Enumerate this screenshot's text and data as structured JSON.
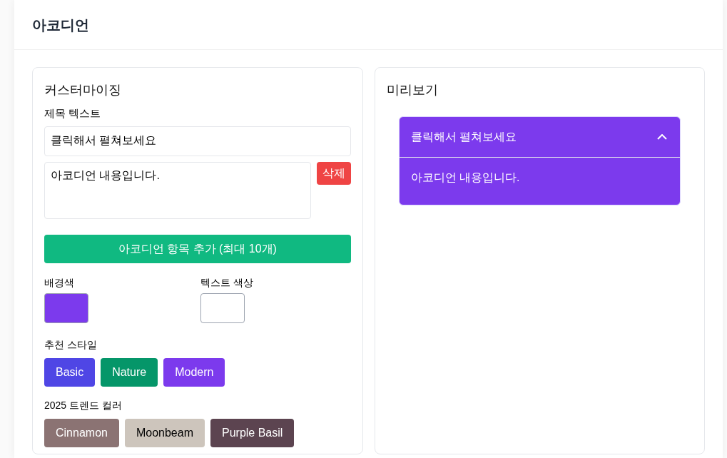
{
  "header": {
    "title": "아코디언"
  },
  "customize": {
    "title": "커스터마이징",
    "title_label": "제목 텍스트",
    "title_value": "클릭해서 펼쳐보세요",
    "items": [
      {
        "content": "아코디언 내용입니다.",
        "delete_label": "삭제"
      }
    ],
    "add_button": "아코디언 항목 추가 (최대 10개)",
    "bg_color": {
      "label": "배경색",
      "color": "#7c3aed"
    },
    "text_color": {
      "label": "텍스트 색상",
      "color": "#ffffff"
    },
    "styles_label": "추천 스타일",
    "styles": [
      {
        "label": "Basic",
        "color": "#4f46e5"
      },
      {
        "label": "Nature",
        "color": "#059669"
      },
      {
        "label": "Modern",
        "color": "#7c3aed"
      }
    ],
    "trends_label": "2025 트렌드 컬러",
    "trends": [
      {
        "label": "Cinnamon",
        "color": "#8b7373"
      },
      {
        "label": "Moonbeam",
        "color": "#cdc5bc"
      },
      {
        "label": "Purple Basil",
        "color": "#5c4450"
      }
    ]
  },
  "preview": {
    "title": "미리보기",
    "accordion": [
      {
        "title": "클릭해서 펼쳐보세요",
        "content": "아코디언 내용입니다.",
        "expanded": true
      }
    ]
  }
}
